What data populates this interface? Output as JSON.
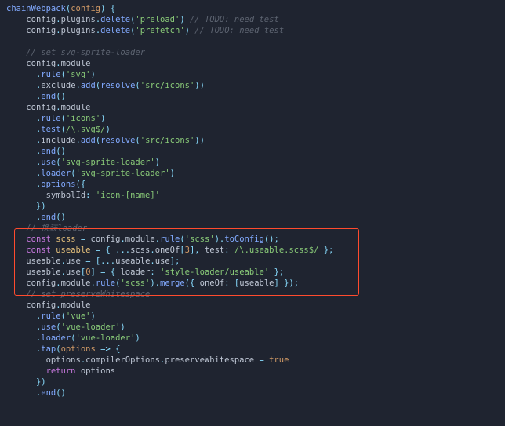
{
  "funcName": "chainWebpack",
  "param": "config",
  "del1": "'preload'",
  "del2": "'prefetch'",
  "cmtNeedTest": "// TODO: need test",
  "cmtSprite": "// set svg-sprite-loader",
  "ruleSvg": "'svg'",
  "srcIcons": "'src/icons'",
  "ruleIcons": "'icons'",
  "svgRegex": "/\\.svg$/",
  "spriteLoader": "'svg-sprite-loader'",
  "symbolPattern": "'icon-[name]'",
  "cmtLoader": "// 换装loader",
  "ruleScss": "'scss'",
  "oneOfIdx": "3",
  "useableRegex": "/\\.useable.scss$/",
  "useZero": "0",
  "styleLoader": "'style-loader/useable'",
  "cmtPreserve": "// set preserveWhitespace",
  "ruleVue": "'vue'",
  "vueLoader": "'vue-loader'",
  "trueLit": "true"
}
